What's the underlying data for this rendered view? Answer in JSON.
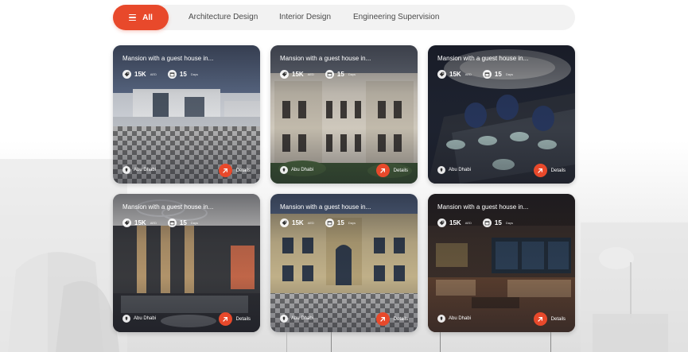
{
  "filters": {
    "all_label": "All",
    "tabs": [
      "Architecture Design",
      "Interior Design",
      "Engineering Supervision"
    ]
  },
  "colors": {
    "accent": "#e8492b",
    "filter_bg": "#f2f2f2",
    "tab_text": "#4a4a4a"
  },
  "icons": [
    "menu-icon",
    "tag-icon",
    "calendar-icon",
    "location-pin-icon",
    "arrow-up-right-icon"
  ],
  "cards": [
    {
      "title": "Mansion with a guest house in...",
      "price": "15K",
      "price_unit": "AED",
      "duration": "15",
      "duration_unit": "Days",
      "location": "Abu Dhabi",
      "details_label": "Details"
    },
    {
      "title": "Mansion with a guest house in...",
      "price": "15K",
      "price_unit": "AED",
      "duration": "15",
      "duration_unit": "Days",
      "location": "Abu Dhabi",
      "details_label": "Details"
    },
    {
      "title": "Mansion with a guest house in...",
      "price": "15K",
      "price_unit": "AED",
      "duration": "15",
      "duration_unit": "Days",
      "location": "Abu Dhabi",
      "details_label": "Details"
    },
    {
      "title": "Mansion with a guest house in...",
      "price": "15K",
      "price_unit": "AED",
      "duration": "15",
      "duration_unit": "Days",
      "location": "Abu Dhabi",
      "details_label": "Details"
    },
    {
      "title": "Mansion with a guest house in...",
      "price": "15K",
      "price_unit": "AED",
      "duration": "15",
      "duration_unit": "Days",
      "location": "Abu Dhabi",
      "details_label": "Details"
    },
    {
      "title": "Mansion with a guest house in...",
      "price": "15K",
      "price_unit": "AED",
      "duration": "15",
      "duration_unit": "Days",
      "location": "Abu Dhabi",
      "details_label": "Details"
    }
  ]
}
